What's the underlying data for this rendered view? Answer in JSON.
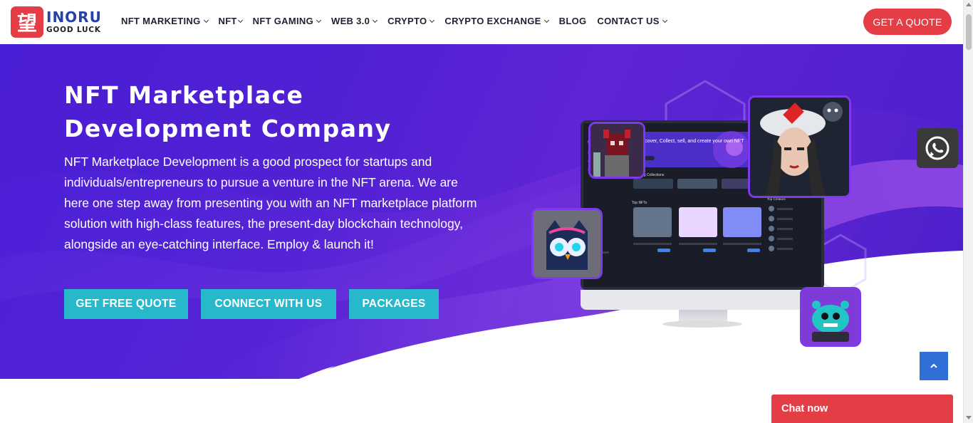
{
  "brand": {
    "logo_glyph": "望",
    "name": "INORU",
    "tagline": "GOOD LUCK",
    "colors": {
      "red": "#e53d45",
      "blue": "#2741a8",
      "hero_purple": "#5524d6",
      "teal": "#28b8cc"
    }
  },
  "nav": {
    "items": [
      {
        "label": "NFT MARKETING",
        "dropdown": true
      },
      {
        "label": "NFT",
        "dropdown": true
      },
      {
        "label": "NFT GAMING",
        "dropdown": true
      },
      {
        "label": "WEB 3.0",
        "dropdown": true
      },
      {
        "label": "CRYPTO",
        "dropdown": true
      },
      {
        "label": "CRYPTO EXCHANGE",
        "dropdown": true
      },
      {
        "label": "BLOG",
        "dropdown": false
      },
      {
        "label": "CONTACT US",
        "dropdown": true
      }
    ],
    "cta": "GET A QUOTE"
  },
  "hero": {
    "title_line1": "NFT Marketplace",
    "title_line2": "Development Company",
    "description": "NFT Marketplace Development is a good prospect for startups and individuals/entrepreneurs to pursue a venture in the NFT arena. We are here one step away from presenting you with an NFT marketplace platform solution with high-class features, the present-day blockchain technology, alongside an eye-catching interface. Employ & launch it!",
    "buttons": [
      "GET FREE QUOTE",
      "CONNECT WITH US",
      "PACKAGES"
    ]
  },
  "mockup": {
    "banner_text": "Discover, Collect, sell, and create your own NFT",
    "sections": [
      "Trending Collections",
      "Top NFTs",
      "Trending Collectors",
      "Top Creators"
    ]
  },
  "floating": {
    "whatsapp_icon": "whatsapp-icon",
    "scroll_top_icon": "chevron-up-icon",
    "chat_label": "Chat now"
  }
}
